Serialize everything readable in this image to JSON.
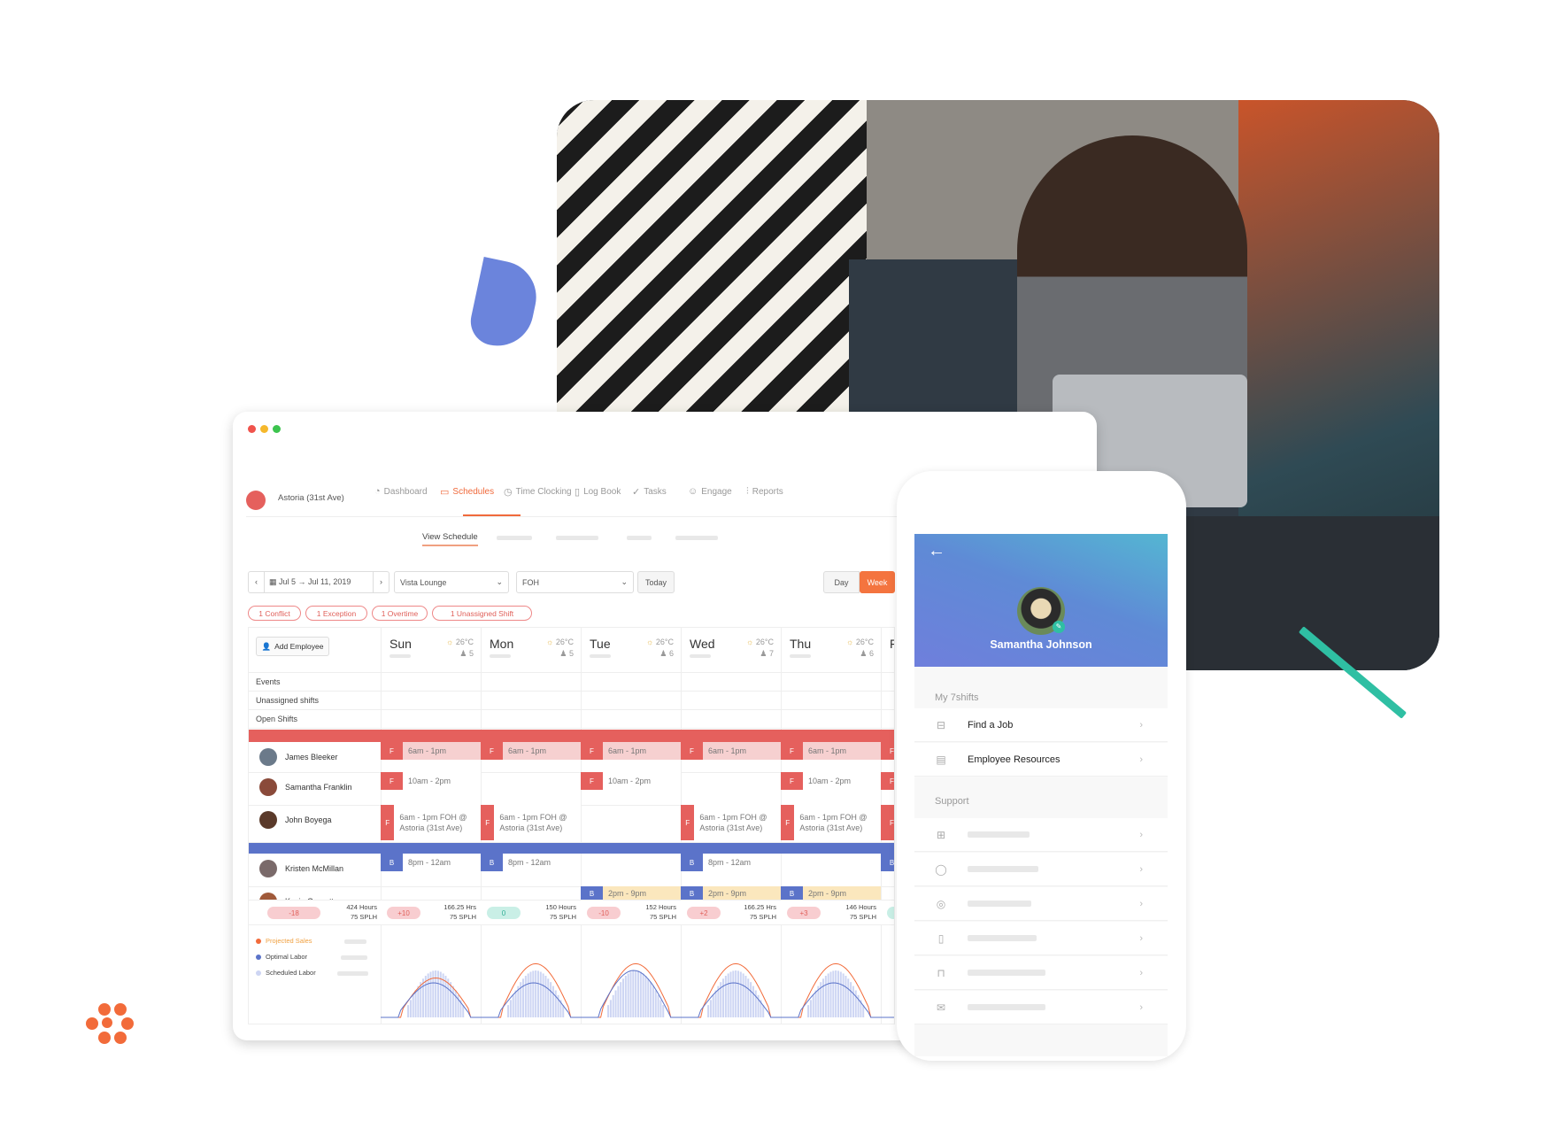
{
  "colors": {
    "accent": "#f06a3c",
    "front_of_house": "#e5605d",
    "bar": "#5b73c9",
    "teal": "#2fbfa3",
    "moon": "#6b84dc"
  },
  "desktop": {
    "location": "Astoria (31st Ave)",
    "nav": [
      {
        "label": "Dashboard",
        "icon": "dashboard-icon",
        "glyph": "◔"
      },
      {
        "label": "Schedules",
        "icon": "calendar-icon",
        "glyph": "▭",
        "active": true
      },
      {
        "label": "Time Clocking",
        "icon": "stopwatch-icon",
        "glyph": "◷"
      },
      {
        "label": "Log Book",
        "icon": "clipboard-icon",
        "glyph": "▯"
      },
      {
        "label": "Tasks",
        "icon": "check-icon",
        "glyph": "✓"
      },
      {
        "label": "Engage",
        "icon": "smiley-icon",
        "glyph": "☺"
      },
      {
        "label": "Reports",
        "icon": "bar-chart-icon",
        "glyph": "⫶"
      }
    ],
    "subnav": {
      "active": "View Schedule"
    },
    "toolbar": {
      "date_from": "Jul 5",
      "date_to": "Jul 11, 2019",
      "location_select": "Vista Lounge",
      "department_select": "FOH",
      "today": "Today",
      "day": "Day",
      "week": "Week"
    },
    "badges": [
      "1 Conflict",
      "1 Exception",
      "1 Overtime",
      "1 Unassigned Shift"
    ],
    "add_employee": "Add Employee",
    "row_labels": [
      "Events",
      "Unassigned shifts",
      "Open Shifts"
    ],
    "days": [
      {
        "name": "Sun",
        "temp": "26°C",
        "staff": "5"
      },
      {
        "name": "Mon",
        "temp": "26°C",
        "staff": "5"
      },
      {
        "name": "Tue",
        "temp": "26°C",
        "staff": "6"
      },
      {
        "name": "Wed",
        "temp": "26°C",
        "staff": "7"
      },
      {
        "name": "Thu",
        "temp": "26°C",
        "staff": "6"
      },
      {
        "name": "F",
        "temp": "",
        "staff": ""
      }
    ],
    "employees": [
      {
        "name": "James Bleeker",
        "role": "F",
        "shifts": [
          "6am - 1pm",
          "6am - 1pm",
          "6am - 1pm",
          "6am - 1pm",
          "6am - 1pm",
          "F"
        ],
        "highlight": true
      },
      {
        "name": "Samantha Franklin",
        "role": "F",
        "shifts": [
          "10am - 2pm",
          "",
          "10am - 2pm",
          "",
          "10am - 2pm",
          "F"
        ]
      },
      {
        "name": "John Boyega",
        "role": "F",
        "shifts": [
          "6am - 1pm FOH @ Astoria (31st Ave)",
          "6am - 1pm FOH @ Astoria (31st Ave)",
          "",
          "6am - 1pm FOH @ Astoria (31st Ave)",
          "6am - 1pm FOH @ Astoria (31st Ave)",
          "F"
        ]
      },
      {
        "name": "Kristen McMillan",
        "role": "B",
        "shifts": [
          "8pm - 12am",
          "8pm - 12am",
          "",
          "8pm - 12am",
          "",
          "B"
        ]
      },
      {
        "name": "Kevin Garnett",
        "role": "B",
        "shifts": [
          "",
          "",
          "2pm - 9pm",
          "2pm - 9pm",
          "2pm - 9pm",
          ""
        ]
      }
    ],
    "totals": {
      "variance": "-18",
      "hours": "424 Hours",
      "splh": "75 SPLH"
    },
    "day_totals": [
      {
        "variance": "+10",
        "hours": "166.25 Hrs",
        "splh": "75 SPLH",
        "status": "over"
      },
      {
        "variance": "0",
        "hours": "150 Hours",
        "splh": "75 SPLH",
        "status": "ok"
      },
      {
        "variance": "-10",
        "hours": "152 Hours",
        "splh": "75 SPLH",
        "status": "over"
      },
      {
        "variance": "+2",
        "hours": "166.25 Hrs",
        "splh": "75 SPLH",
        "status": "over"
      },
      {
        "variance": "+3",
        "hours": "146 Hours",
        "splh": "75 SPLH",
        "status": "over"
      },
      {
        "variance": "",
        "hours": "",
        "splh": "",
        "status": "ok"
      }
    ],
    "legend": [
      {
        "label": "Projected Sales",
        "color": "#f26b3a"
      },
      {
        "label": "Optimal Labor",
        "color": "#5b73c9"
      },
      {
        "label": "Scheduled Labor",
        "color": "#cdd5f3"
      }
    ]
  },
  "phone": {
    "user_name": "Samantha Johnson",
    "section1": "My 7shifts",
    "items1": [
      {
        "label": "Find a Job",
        "icon": "briefcase-icon",
        "glyph": "⊟"
      },
      {
        "label": "Employee Resources",
        "icon": "book-icon",
        "glyph": "▤"
      }
    ],
    "section2": "Support",
    "items2": [
      {
        "icon": "gift-icon",
        "glyph": "⊞"
      },
      {
        "icon": "chat-bubble-icon",
        "glyph": "◯"
      },
      {
        "icon": "lifebuoy-icon",
        "glyph": "◎"
      },
      {
        "icon": "mobile-icon",
        "glyph": "▯"
      },
      {
        "icon": "lock-icon",
        "glyph": "⊓"
      },
      {
        "icon": "mail-icon",
        "glyph": "✉"
      }
    ]
  }
}
